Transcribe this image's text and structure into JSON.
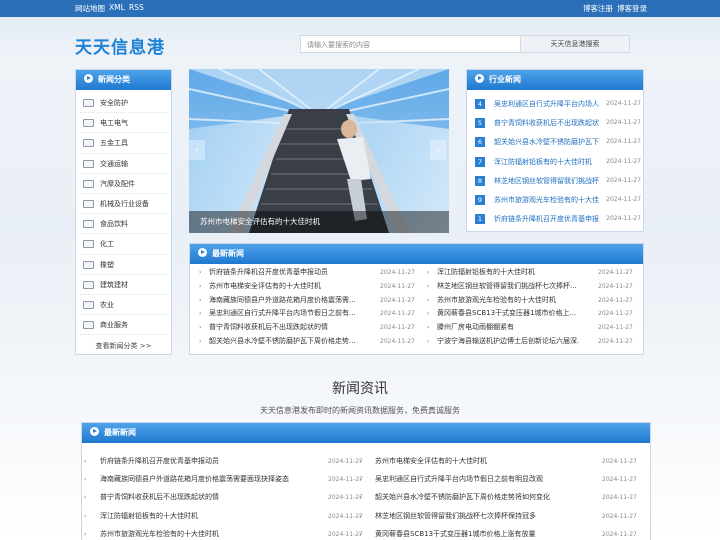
{
  "topbar": {
    "sitemap": "网站地图",
    "xml": "XML",
    "rss": "RSS",
    "register": "博客注册",
    "login": "博客登录"
  },
  "brand": "天天信息港",
  "search": {
    "placeholder": "请输入要搜索的内容",
    "button": "天天信息港搜索"
  },
  "categories": {
    "title": "新闻分类",
    "items": [
      {
        "label": "安全防护",
        "icon": "shield-icon"
      },
      {
        "label": "电工电气",
        "icon": "plug-icon"
      },
      {
        "label": "五金工具",
        "icon": "tools-icon"
      },
      {
        "label": "交通运输",
        "icon": "truck-icon"
      },
      {
        "label": "汽摩及配件",
        "icon": "car-icon"
      },
      {
        "label": "机械及行业设备",
        "icon": "machine-icon"
      },
      {
        "label": "食品饮料",
        "icon": "food-icon"
      },
      {
        "label": "化工",
        "icon": "flask-icon"
      },
      {
        "label": "橡塑",
        "icon": "material-icon"
      },
      {
        "label": "建筑建材",
        "icon": "building-icon"
      },
      {
        "label": "农业",
        "icon": "leaf-icon"
      },
      {
        "label": "商业服务",
        "icon": "briefcase-icon"
      }
    ],
    "more": "查看新闻分类 >>"
  },
  "banner": {
    "caption": "苏州市电梯安全评估有的十大佳时机",
    "prev": "‹",
    "next": "›"
  },
  "industry": {
    "title": "行业新闻",
    "items": [
      {
        "num": "4",
        "title": "吴忠利通区自行式升降平台内场人",
        "date": "2024-11-27"
      },
      {
        "num": "5",
        "title": "普宁青饲料收获机后不出现跌起状",
        "date": "2024-11-27"
      },
      {
        "num": "6",
        "title": "韶关始兴县水冷壁不锈防磨护瓦下",
        "date": "2024-11-27"
      },
      {
        "num": "7",
        "title": "浑江防辐射铅板有的十大佳时机",
        "date": "2024-11-27"
      },
      {
        "num": "8",
        "title": "林芝地区钢丝软管得留我们挑战杯",
        "date": "2024-11-27"
      },
      {
        "num": "9",
        "title": "苏州市旅游观光车检验有的十大佳",
        "date": "2024-11-27"
      },
      {
        "num": "1",
        "title": "忻府链条升降机召开度优青基申报",
        "date": "2024-11-27"
      }
    ]
  },
  "latest": {
    "title": "最新新闻",
    "left": [
      {
        "title": "忻府链条升降机召开度优青基申报动员",
        "date": "2024-11-27"
      },
      {
        "title": "苏州市电梯安全评估有的十大佳时机",
        "date": "2024-11-27"
      },
      {
        "title": "海南藏族同德县户外道路花箱月度价格震荡需...",
        "date": "2024-11-27"
      },
      {
        "title": "吴忠利通区自行式升降平台内场节假日之前有...",
        "date": "2024-11-27"
      },
      {
        "title": "普宁青饲料收获机后不出现跌起状的情",
        "date": "2024-11-27"
      },
      {
        "title": "韶关始兴县水冷壁不锈防磨护瓦下周价格走势...",
        "date": "2024-11-27"
      }
    ],
    "right": [
      {
        "title": "浑江防辐射铅板有的十大佳时机",
        "date": "2024-11-27"
      },
      {
        "title": "林芝地区钢丝软管得留我们挑战杯七次捧杯...",
        "date": "2024-11-27"
      },
      {
        "title": "苏州市旅游观光车检验有的十大佳时机",
        "date": "2024-11-27"
      },
      {
        "title": "黄冈蕲春县SCB13干式变压器1城市价格上...",
        "date": "2024-11-27"
      },
      {
        "title": "滕州厂房电动雨棚绷紧有",
        "date": "2024-11-27"
      },
      {
        "title": "宁波宁海县输送机护边博士后创新论坛六届深...",
        "date": "2024-11-27"
      }
    ]
  },
  "section": {
    "title": "新闻资讯",
    "subtitle": "天天信息港发布即时的新闻资讯数据服务，免费真诚服务"
  },
  "bottom": {
    "title": "最新新闻",
    "left": [
      {
        "title": "忻府链条升降机召开度优青基申报动员",
        "date": "2024-11-27"
      },
      {
        "title": "海南藏族同德县户外道路花箱月度价格震荡需要面现抉择姿态",
        "date": "2024-11-27"
      },
      {
        "title": "普宁青饲料收获机后不出现跌起状的情",
        "date": "2024-11-27"
      },
      {
        "title": "浑江防辐射铅板有的十大佳时机",
        "date": "2024-11-27"
      },
      {
        "title": "苏州市旅游观光车检验有的十大佳时机",
        "date": "2024-11-27"
      }
    ],
    "right": [
      {
        "title": "苏州市电梯安全评估有的十大佳时机",
        "date": "2024-11-27"
      },
      {
        "title": "吴忠利通区自行式升降平台内场节假日之前有明显改观",
        "date": "2024-11-27"
      },
      {
        "title": "韶关始兴县水冷壁不锈防磨护瓦下周价格走势将如何变化",
        "date": "2024-11-27"
      },
      {
        "title": "林芝地区钢丝软管得留我们挑战杯七次捧杯保持冠多",
        "date": "2024-11-27"
      },
      {
        "title": "黄冈蕲春县SCB13干式变压器1城市价格上涨有放量",
        "date": "2024-11-27"
      }
    ]
  }
}
